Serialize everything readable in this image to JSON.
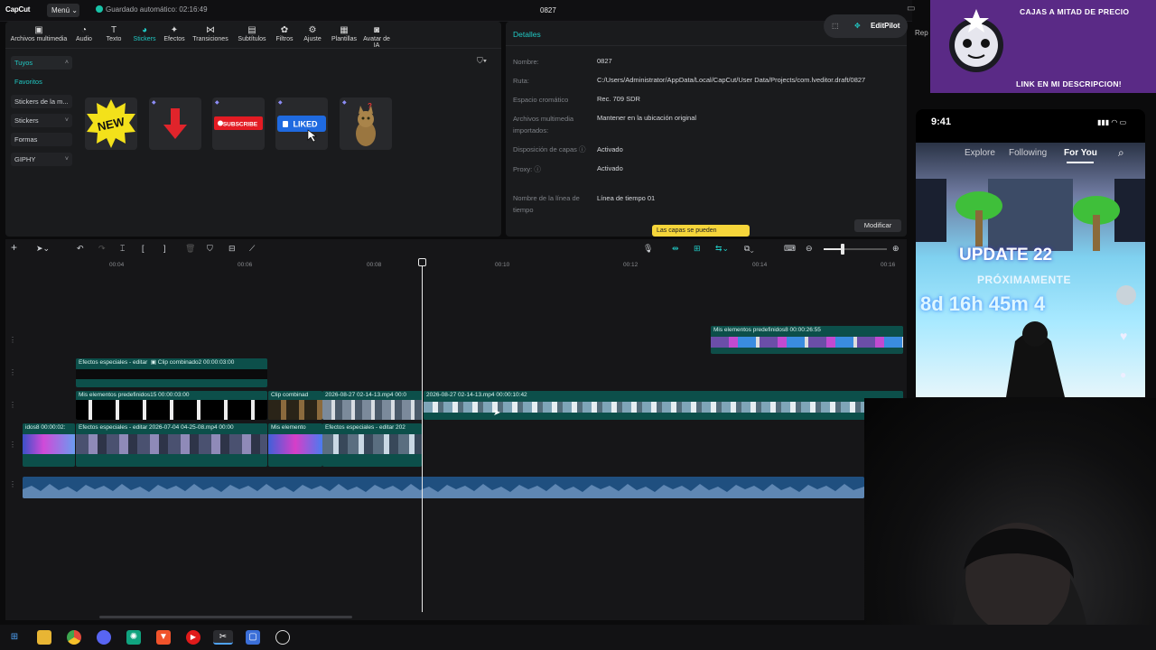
{
  "app": {
    "logo": "CapCut",
    "menu": "Menú",
    "autosave": "Guardado automático: 02:16:49",
    "project_title": "0827"
  },
  "media_tabs": [
    {
      "icon": "media-icon",
      "label": "Archivos multimedia"
    },
    {
      "icon": "audio-icon",
      "label": "Audio"
    },
    {
      "icon": "text-icon",
      "label": "Texto"
    },
    {
      "icon": "sticker-icon",
      "label": "Stickers"
    },
    {
      "icon": "effects-icon",
      "label": "Efectos"
    },
    {
      "icon": "transitions-icon",
      "label": "Transiciones"
    },
    {
      "icon": "subtitles-icon",
      "label": "Subtítulos"
    },
    {
      "icon": "filters-icon",
      "label": "Filtros"
    },
    {
      "icon": "adjust-icon",
      "label": "Ajuste"
    },
    {
      "icon": "templates-icon",
      "label": "Plantillas"
    },
    {
      "icon": "ai-avatar-icon",
      "label": "Avatar de IA"
    }
  ],
  "sidebar": [
    "Tuyos",
    "Favoritos",
    "Stickers de la m...",
    "Stickers",
    "Formas",
    "GIPHY"
  ],
  "stickers": [
    "NEW",
    "down-arrow",
    "SUBSCRIBE",
    "LIKED",
    "cat"
  ],
  "details": {
    "title": "Detalles",
    "fields": [
      {
        "label": "Nombre:",
        "value": "0827"
      },
      {
        "label": "Ruta:",
        "value": "C:/Users/Administrator/AppData/Local/CapCut/User Data/Projects/com.lveditor.draft/0827"
      },
      {
        "label": "Espacio cromático",
        "value": "Rec. 709 SDR"
      },
      {
        "label": "Archivos multimedia importados:",
        "value": "Mantener en la ubicación original"
      },
      {
        "label": "Disposición de capas ⓘ",
        "value": "Activado"
      },
      {
        "label": "Proxy: ⓘ",
        "value": "Activado"
      },
      {
        "label": "Nombre de la línea de tiempo",
        "value": "Línea de tiempo 01"
      }
    ],
    "modify": "Modificar",
    "tooltip": "Las capas se pueden"
  },
  "editpilot": "EditPilot",
  "rep_tab": "Rep",
  "ruler": [
    "00:04",
    "00:06",
    "00:08",
    "00:10",
    "00:12",
    "00:14",
    "00:16"
  ],
  "clips": {
    "c1": "Mis elementos predefinidos8   00:00:26:55",
    "c2a": "Efectos especiales - editar",
    "c2b": "Clip combinado2   00:00:03:00",
    "c3a": "Mis elementos predefinidos15   00:00:03:00",
    "c3b": "Clip combinad",
    "c3c": "2026-08-27 02-14-13.mp4   00:0",
    "c3d": "2026-08-27 02-14-13.mp4   00:00:10:42",
    "c4a": "idos8   00:00:02:",
    "c4b": "Efectos especiales - editar   2026-07-04 04-25-08.mp4   00:00",
    "c4c": "Mis elemento",
    "c4d": "Efectos especiales - editar   202"
  },
  "overlay": {
    "banner_top": "CAJAS A MITAD DE PRECIO",
    "banner_bottom": "LINK EN MI DESCRIPCION!",
    "phone_time": "9:41",
    "feed_tabs": [
      "Explore",
      "Following",
      "For You"
    ],
    "update_text": "UPDATE 22",
    "proximamente": "PRÓXIMAMENTE",
    "countdown": "8d 16h 45m 4"
  },
  "taskbar": [
    "windows-icon",
    "files-icon",
    "chrome-icon",
    "discord-icon",
    "chatgpt-icon",
    "brave-icon",
    "youtube-icon",
    "capcut-icon",
    "notes-icon",
    "obs-icon"
  ]
}
